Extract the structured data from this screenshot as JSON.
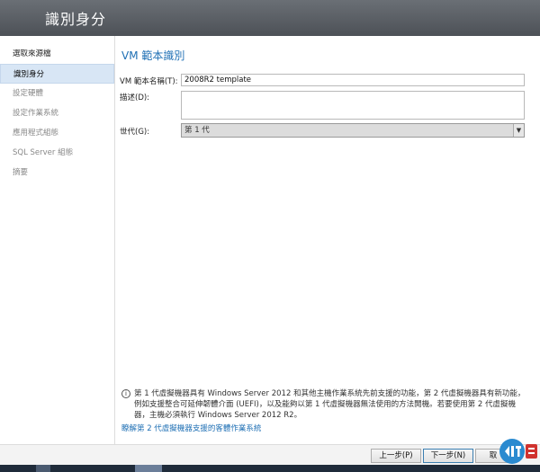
{
  "header": {
    "title": "識別身分"
  },
  "sidebar": {
    "items": [
      {
        "label": "選取來源檔"
      },
      {
        "label": "識別身分"
      },
      {
        "label": "設定硬體"
      },
      {
        "label": "設定作業系統"
      },
      {
        "label": "應用程式組態"
      },
      {
        "label": "SQL Server 組態"
      },
      {
        "label": "摘要"
      }
    ]
  },
  "main": {
    "heading": "VM 範本識別",
    "name_label": "VM 範本名稱(T):",
    "name_value": "2008R2 template",
    "desc_label": "描述(D):",
    "desc_value": "",
    "gen_label": "世代(G):",
    "gen_value": "第 1 代"
  },
  "info": {
    "icon": "i",
    "text": "第 1 代虛擬機器具有 Windows Server 2012 和其他主機作業系統先前支援的功能，第 2 代虛擬機器具有新功能，例如支援整合可延伸韌體介面 (UEFI)，以及能夠以第 1 代虛擬機器無法使用的方法開機。若要使用第 2 代虛擬機器，主機必須執行 Windows Server 2012 R2。",
    "link": "瞭解第 2 代虛擬機器支援的客體作業系統"
  },
  "footer": {
    "prev_label": "上一步(P)",
    "next_label": "下一步(N)",
    "cancel_label": "取"
  },
  "colors": {
    "accent": "#1e6fb4",
    "header_bg": "#565b61",
    "active_item": "#d8e6f5"
  }
}
